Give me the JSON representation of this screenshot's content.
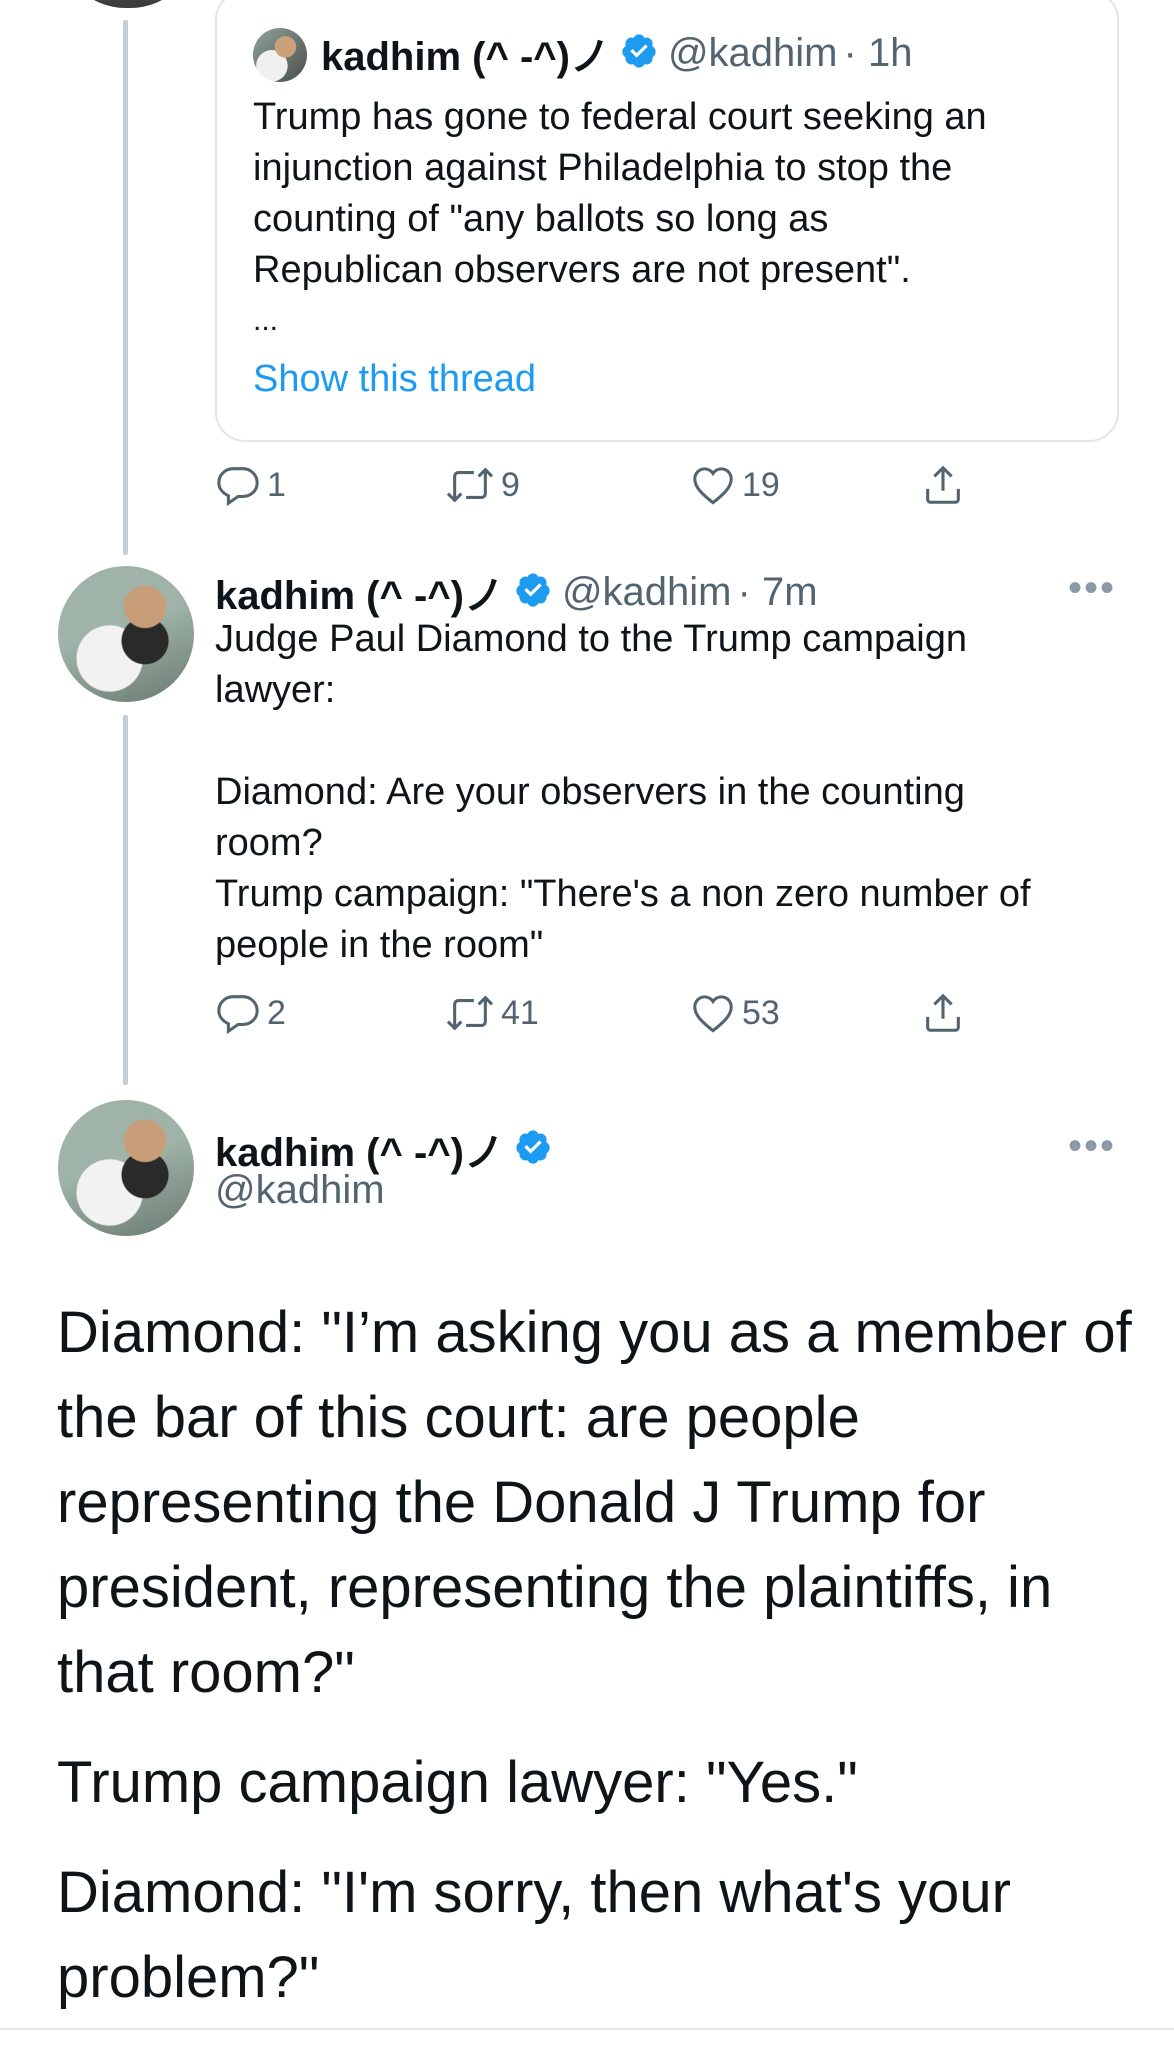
{
  "quoted_tweet": {
    "author_name": "kadhim (^ -^)ノ",
    "author_handle": "@kadhim",
    "time": "· 1h",
    "lines": [
      "Trump has gone to federal court seeking an",
      "injunction against Philadelphia to stop the",
      "counting of \"any ballots so long as",
      "Republican observers are not present\"."
    ],
    "ellipsis": "...",
    "show_thread": "Show this thread"
  },
  "tweet1_actions": {
    "replies": "1",
    "retweets": "9",
    "likes": "19"
  },
  "tweet2": {
    "author_name": "kadhim (^ -^)ノ",
    "author_handle": "@kadhim",
    "time": "· 7m",
    "lines": [
      "Judge Paul Diamond to the Trump campaign",
      "lawyer:",
      "",
      "Diamond: Are your observers in the counting",
      "room?",
      "Trump campaign: \"There's a non zero number of",
      "people in the room\""
    ],
    "replies": "2",
    "retweets": "41",
    "likes": "53"
  },
  "tweet3": {
    "author_name": "kadhim (^ -^)ノ",
    "author_handle": "@kadhim",
    "paragraph1": [
      "Diamond: \"I’m asking you as a member of",
      "the bar of this court: are people",
      "representing the Donald J Trump for",
      "president, representing the plaintiffs, in",
      "that room?\""
    ],
    "paragraph2": "Trump campaign lawyer: \"Yes.\"",
    "paragraph3": [
      "Diamond: \"I'm sorry, then what's your",
      "problem?\""
    ]
  },
  "icons": {
    "reply": "reply-icon",
    "retweet": "retweet-icon",
    "like": "heart-icon",
    "share": "share-icon",
    "verified": "verified-badge-icon",
    "more": "more-options-icon"
  },
  "colors": {
    "accent": "#1d9bf0",
    "muted": "#536471",
    "thread_line": "#c4cfd6"
  }
}
